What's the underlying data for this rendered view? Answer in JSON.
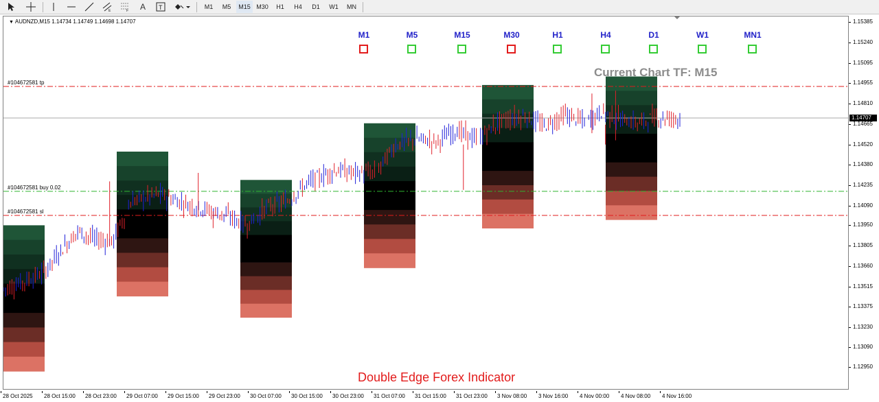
{
  "toolbar": {
    "timeframes": [
      "M1",
      "M5",
      "M15",
      "M30",
      "H1",
      "H4",
      "D1",
      "W1",
      "MN"
    ],
    "tools": [
      "cursor-icon",
      "crosshair-icon",
      "vertical-line-icon",
      "horizontal-line-icon",
      "trendline-icon",
      "equidistant-channel-icon",
      "fibonacci-icon",
      "text-icon",
      "text-label-icon",
      "arrows-icon"
    ]
  },
  "chart": {
    "symbol_info": "AUDNZD,M15  1.14734 1.14749 1.14698 1.14707",
    "current_tf": "Current Chart TF: M15",
    "brand": "Double Edge Forex Indicator",
    "tf_panel": [
      {
        "label": "M1",
        "state": "red"
      },
      {
        "label": "M5",
        "state": "green"
      },
      {
        "label": "M15",
        "state": "green"
      },
      {
        "label": "M30",
        "state": "red"
      },
      {
        "label": "H1",
        "state": "green"
      },
      {
        "label": "H4",
        "state": "green"
      },
      {
        "label": "D1",
        "state": "green"
      },
      {
        "label": "W1",
        "state": "green"
      },
      {
        "label": "MN1",
        "state": "green"
      }
    ],
    "orders": [
      {
        "label": "#104672581 tp",
        "price": 1.1493,
        "color": "#e21b1b"
      },
      {
        "label": "#104672581 buy 0.02",
        "price": 1.1419,
        "color": "#2fb52f"
      },
      {
        "label": "#104672581 sl",
        "price": 1.1402,
        "color": "#e21b1b"
      }
    ],
    "current_price": "1.14707",
    "current_price_value": 1.14707,
    "colors": {
      "tf_title": "#1f1fc8",
      "box_red": "#e21b1b",
      "box_green": "#33cc33",
      "bull": "#1f1fd8",
      "bear": "#e0202a"
    }
  },
  "price_axis": {
    "ticks": [
      "1.15385",
      "1.15240",
      "1.15095",
      "1.14955",
      "1.14810",
      "1.14665",
      "1.14520",
      "1.14380",
      "1.14235",
      "1.14090",
      "1.13950",
      "1.13805",
      "1.13660",
      "1.13515",
      "1.13375",
      "1.13230",
      "1.13090",
      "1.12950"
    ]
  },
  "time_axis": {
    "labels": [
      "28 Oct 2025",
      "28 Oct 15:00",
      "28 Oct 23:00",
      "29 Oct 07:00",
      "29 Oct 15:00",
      "29 Oct 23:00",
      "30 Oct 07:00",
      "30 Oct 15:00",
      "30 Oct 23:00",
      "31 Oct 07:00",
      "31 Oct 15:00",
      "31 Oct 23:00",
      "3 Nov 08:00",
      "3 Nov 16:00",
      "4 Nov 00:00",
      "4 Nov 08:00",
      "4 Nov 16:00"
    ]
  },
  "chart_data": {
    "type": "candlestick",
    "symbol": "AUDNZD",
    "timeframe": "M15",
    "ylim": [
      1.1295,
      1.154
    ],
    "zones": [
      {
        "start": "28 Oct 2025",
        "top": 1.1395,
        "bottom": 1.1292
      },
      {
        "start": "29 Oct 07:00",
        "top": 1.1447,
        "bottom": 1.1345
      },
      {
        "start": "30 Oct 07:00",
        "top": 1.1427,
        "bottom": 1.133
      },
      {
        "start": "31 Oct 07:00",
        "top": 1.1467,
        "bottom": 1.1365
      },
      {
        "start": "3 Nov 08:00",
        "top": 1.1494,
        "bottom": 1.1393
      },
      {
        "start": "4 Nov 08:00",
        "top": 1.15,
        "bottom": 1.1399
      }
    ],
    "price_path": [
      [
        0,
        1.135
      ],
      [
        0.03,
        1.1355
      ],
      [
        0.06,
        1.1362
      ],
      [
        0.09,
        1.138
      ],
      [
        0.11,
        1.1391
      ],
      [
        0.13,
        1.1386
      ],
      [
        0.16,
        1.1383
      ],
      [
        0.19,
        1.1412
      ],
      [
        0.23,
        1.1417
      ],
      [
        0.27,
        1.141
      ],
      [
        0.3,
        1.1406
      ],
      [
        0.33,
        1.1402
      ],
      [
        0.36,
        1.1395
      ],
      [
        0.39,
        1.1408
      ],
      [
        0.42,
        1.1412
      ],
      [
        0.45,
        1.1425
      ],
      [
        0.49,
        1.1434
      ],
      [
        0.52,
        1.1432
      ],
      [
        0.55,
        1.1432
      ],
      [
        0.58,
        1.1452
      ],
      [
        0.61,
        1.1456
      ],
      [
        0.64,
        1.1454
      ],
      [
        0.67,
        1.1462
      ],
      [
        0.7,
        1.1455
      ],
      [
        0.735,
        1.1469
      ],
      [
        0.77,
        1.1472
      ],
      [
        0.8,
        1.1465
      ],
      [
        0.83,
        1.1473
      ],
      [
        0.86,
        1.1468
      ],
      [
        0.885,
        1.1475
      ],
      [
        0.91,
        1.147
      ],
      [
        0.94,
        1.1467
      ],
      [
        0.96,
        1.1471
      ],
      [
        1.0,
        1.14707
      ]
    ]
  }
}
